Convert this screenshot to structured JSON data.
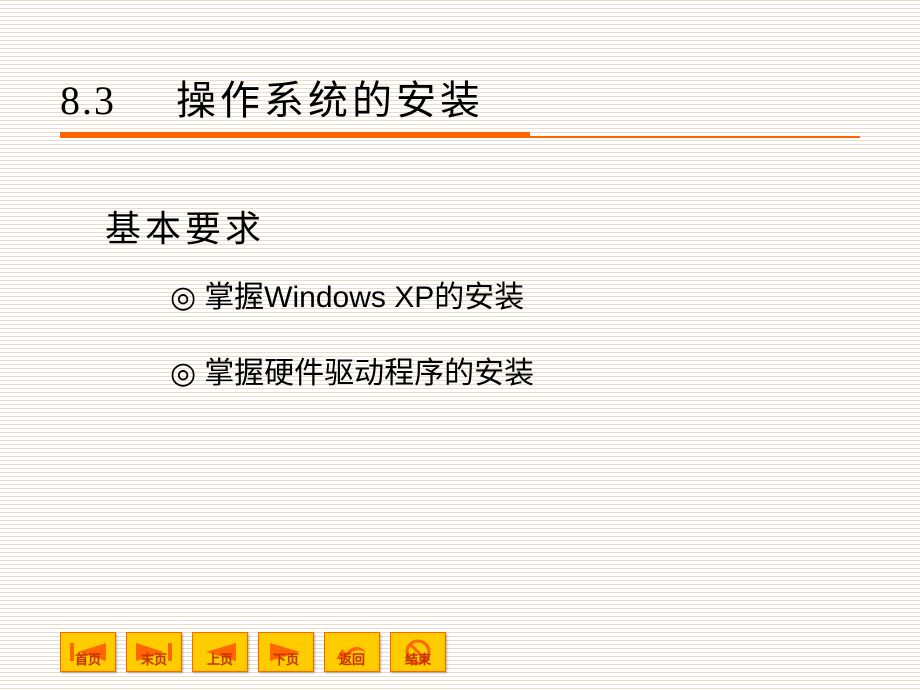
{
  "header": {
    "section_number": "8.3",
    "section_title": "操作系统的安装"
  },
  "subheading": "基本要求",
  "bullets": [
    {
      "marker": "◎",
      "text": "掌握Windows XP的安装"
    },
    {
      "marker": "◎",
      "text": "掌握硬件驱动程序的安装"
    }
  ],
  "nav": {
    "first": "首页",
    "last": "末页",
    "prev": "上页",
    "next": "下页",
    "back": "返回",
    "end": "结束"
  }
}
